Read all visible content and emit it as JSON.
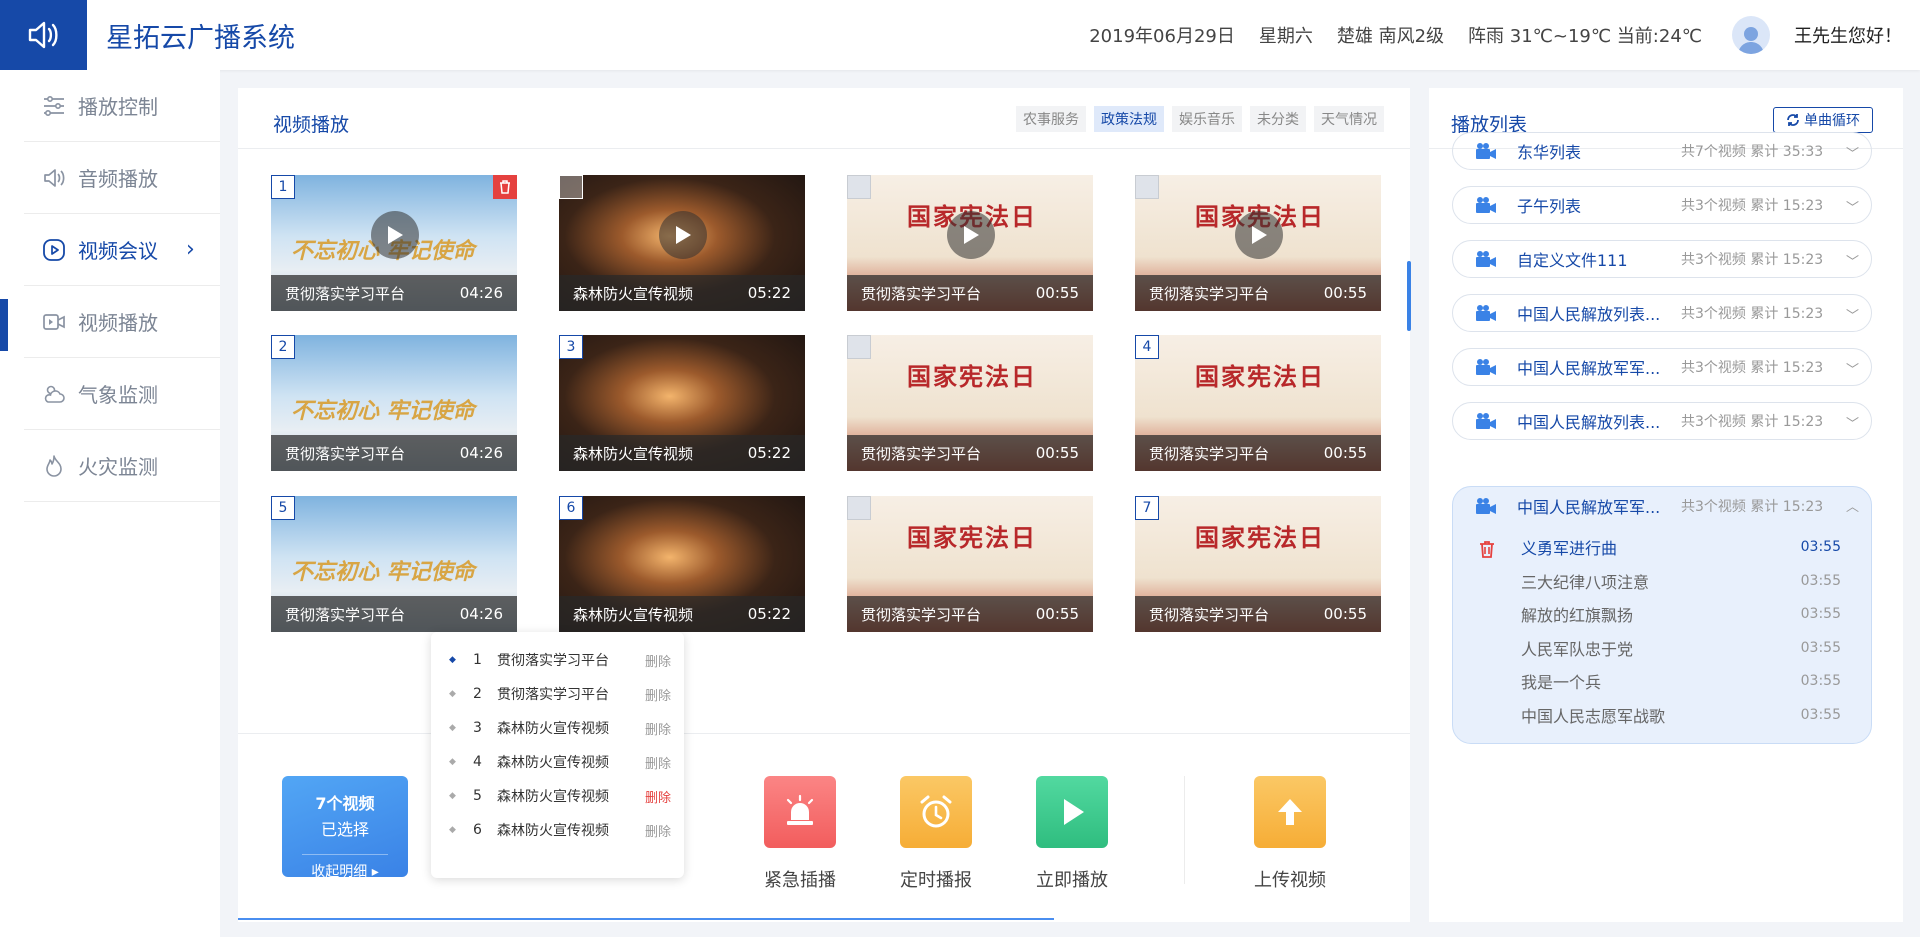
{
  "header": {
    "title": "星拓云广播系统",
    "date": "2019年06月29日",
    "weekday": "星期六",
    "location_wind": "楚雄 南风2级",
    "weather": "阵雨 31℃~19℃ 当前:24℃",
    "greeting": "王先生您好！"
  },
  "sidebar": {
    "items": [
      {
        "label": "播放控制",
        "icon": "sliders-icon"
      },
      {
        "label": "音频播放",
        "icon": "speaker-icon"
      },
      {
        "label": "视频会议",
        "icon": "play-circle-icon"
      },
      {
        "label": "视频播放",
        "icon": "video-camera-icon"
      },
      {
        "label": "气象监测",
        "icon": "weather-icon"
      },
      {
        "label": "火灾监测",
        "icon": "flame-icon"
      }
    ],
    "active": "视频会议",
    "chevron": "›"
  },
  "main": {
    "title": "视频播放",
    "categories": [
      "农事服务",
      "政策法规",
      "娱乐音乐",
      "未分类",
      "天气情况"
    ],
    "active_category": "政策法规",
    "videos": [
      {
        "title": "贯彻落实学习平台",
        "duration": "04:26",
        "badge": "1",
        "theme": "party"
      },
      {
        "title": "森林防火宣传视频",
        "duration": "05:22",
        "badge": "",
        "theme": "fire"
      },
      {
        "title": "贯彻落实学习平台",
        "duration": "00:55",
        "badge": "",
        "theme": "law"
      },
      {
        "title": "贯彻落实学习平台",
        "duration": "00:55",
        "badge": "",
        "theme": "law"
      },
      {
        "title": "贯彻落实学习平台",
        "duration": "04:26",
        "badge": "2",
        "theme": "party"
      },
      {
        "title": "森林防火宣传视频",
        "duration": "05:22",
        "badge": "3",
        "theme": "fire"
      },
      {
        "title": "贯彻落实学习平台",
        "duration": "00:55",
        "badge": "",
        "theme": "law"
      },
      {
        "title": "贯彻落实学习平台",
        "duration": "00:55",
        "badge": "4",
        "theme": "law"
      },
      {
        "title": "贯彻落实学习平台",
        "duration": "04:26",
        "badge": "5",
        "theme": "party"
      },
      {
        "title": "森林防火宣传视频",
        "duration": "05:22",
        "badge": "6",
        "theme": "fire"
      },
      {
        "title": "贯彻落实学习平台",
        "duration": "00:55",
        "badge": "",
        "theme": "law"
      },
      {
        "title": "贯彻落实学习平台",
        "duration": "00:55",
        "badge": "7",
        "theme": "law"
      }
    ],
    "thumb_text": {
      "law": "国家宪法日",
      "party": "不忘初心 牢记使命"
    }
  },
  "selection": {
    "count": "7个视频",
    "status": "已选择",
    "toggle": "收起明细 ▸"
  },
  "popup": {
    "rows": [
      {
        "n": "1",
        "title": "贯彻落实学习平台",
        "del": "删除"
      },
      {
        "n": "2",
        "title": "贯彻落实学习平台",
        "del": "删除"
      },
      {
        "n": "3",
        "title": "森林防火宣传视频",
        "del": "删除"
      },
      {
        "n": "4",
        "title": "森林防火宣传视频",
        "del": "删除"
      },
      {
        "n": "5",
        "title": "森林防火宣传视频",
        "del": "删除"
      },
      {
        "n": "6",
        "title": "森林防火宣传视频",
        "del": "删除"
      }
    ]
  },
  "actions": [
    {
      "label": "紧急插播",
      "color": "#f46a6a",
      "icon": "alarm-light-icon"
    },
    {
      "label": "定时播报",
      "color": "#f7b84a",
      "icon": "alarm-clock-icon"
    },
    {
      "label": "立即播放",
      "color": "#3cc98e",
      "icon": "play-icon"
    },
    {
      "label": "上传视频",
      "color": "#f7b84a",
      "icon": "upload-arrow-icon"
    }
  ],
  "playlist": {
    "title": "播放列表",
    "loop_label": "单曲循环",
    "lists": [
      {
        "name": "东华列表",
        "info": "共7个视频 累计 35:33"
      },
      {
        "name": "子午列表",
        "info": "共3个视频 累计 15:23"
      },
      {
        "name": "自定义文件111",
        "info": "共3个视频 累计 15:23"
      },
      {
        "name": "中国人民解放列表...",
        "info": "共3个视频 累计 15:23"
      },
      {
        "name": "中国人民解放军军...",
        "info": "共3个视频 累计 15:23"
      },
      {
        "name": "中国人民解放列表...",
        "info": "共3个视频 累计 15:23"
      }
    ],
    "open": {
      "name": "中国人民解放军军...",
      "info": "共3个视频 累计 15:23",
      "items": [
        {
          "title": "义勇军进行曲",
          "time": "03:55"
        },
        {
          "title": "三大纪律八项注意",
          "time": "03:55"
        },
        {
          "title": "解放的红旗飘扬",
          "time": "03:55"
        },
        {
          "title": "人民军队忠于党",
          "time": "03:55"
        },
        {
          "title": "我是一个兵",
          "time": "03:55"
        },
        {
          "title": "中国人民志愿军战歌",
          "time": "03:55"
        }
      ]
    }
  },
  "colors": {
    "brand": "#1649a8",
    "accent": "#3a82e6",
    "danger": "#e5413f"
  }
}
